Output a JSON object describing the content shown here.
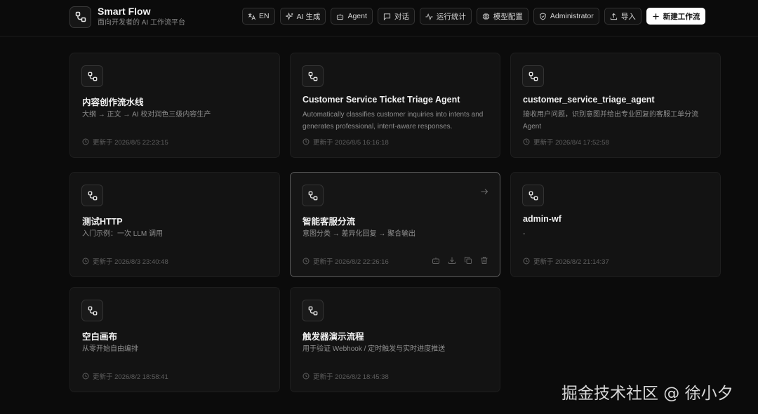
{
  "brand": {
    "title": "Smart Flow",
    "subtitle": "面向开发者的 AI 工作流平台"
  },
  "nav": {
    "lang": "EN",
    "ai_generate": "AI 生成",
    "agent": "Agent",
    "chat": "对话",
    "stats": "运行统计",
    "model_config": "模型配置",
    "user": "Administrator",
    "import": "导入",
    "new_workflow": "新建工作流"
  },
  "cards": [
    {
      "title": "内容创作流水线",
      "desc": "大纲 → 正文 → AI 校对润色三级内容生产",
      "time": "更新于 2026/8/5 22:23:15"
    },
    {
      "title": "Customer Service Ticket Triage Agent",
      "desc": "Automatically classifies customer inquiries into intents and generates professional, intent-aware responses.",
      "time": "更新于 2026/8/5 16:16:18"
    },
    {
      "title": "customer_service_triage_agent",
      "desc": "接收用户问题，识别意图并给出专业回复的客服工单分流Agent",
      "time": "更新于 2026/8/4 17:52:58"
    },
    {
      "title": "测试HTTP",
      "desc": "入门示例：一次 LLM 调用",
      "time": "更新于 2026/8/3 23:40:48"
    },
    {
      "title": "智能客服分流",
      "desc": "意图分类 → 差异化回复 → 聚合输出",
      "time": "更新于 2026/8/2 22:26:16"
    },
    {
      "title": "admin-wf",
      "desc": "-",
      "time": "更新于 2026/8/2 21:14:37"
    },
    {
      "title": "空白画布",
      "desc": "从零开始自由编排",
      "time": "更新于 2026/8/2 18:58:41"
    },
    {
      "title": "触发器演示流程",
      "desc": "用于验证 Webhook / 定时触发与实时进度推送",
      "time": "更新于 2026/8/2 18:45:38"
    }
  ],
  "watermark": "掘金技术社区 @ 徐小夕",
  "icons": {
    "logo": "workflow-nodes-icon",
    "lang": "translate-icon",
    "ai_generate": "sparkles-icon",
    "agent": "bot-icon",
    "chat": "message-square-icon",
    "stats": "activity-icon",
    "model_config": "cpu-icon",
    "user": "shield-icon",
    "import": "upload-icon",
    "new_workflow": "plus-icon",
    "time": "clock-icon",
    "open": "arrow-right-icon",
    "actions": [
      "bot-icon",
      "download-icon",
      "copy-icon",
      "trash-icon"
    ]
  }
}
